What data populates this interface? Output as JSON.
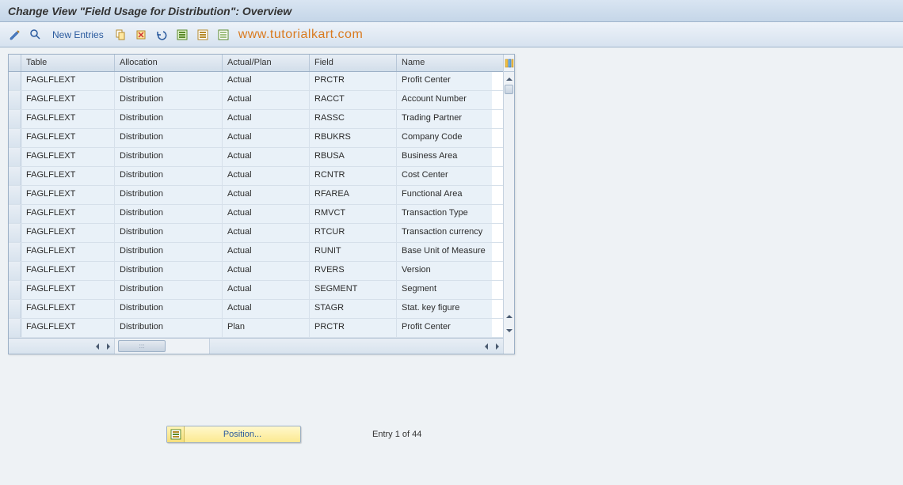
{
  "title": "Change View \"Field Usage for Distribution\": Overview",
  "toolbar": {
    "new_entries": "New Entries"
  },
  "watermark": "www.tutorialkart.com",
  "grid": {
    "headers": {
      "table": "Table",
      "allocation": "Allocation",
      "actual_plan": "Actual/Plan",
      "field": "Field",
      "name": "Name"
    },
    "rows": [
      {
        "table": "FAGLFLEXT",
        "allocation": "Distribution",
        "actual_plan": "Actual",
        "field": "PRCTR",
        "name": "Profit Center"
      },
      {
        "table": "FAGLFLEXT",
        "allocation": "Distribution",
        "actual_plan": "Actual",
        "field": "RACCT",
        "name": "Account Number"
      },
      {
        "table": "FAGLFLEXT",
        "allocation": "Distribution",
        "actual_plan": "Actual",
        "field": "RASSC",
        "name": "Trading Partner"
      },
      {
        "table": "FAGLFLEXT",
        "allocation": "Distribution",
        "actual_plan": "Actual",
        "field": "RBUKRS",
        "name": "Company Code"
      },
      {
        "table": "FAGLFLEXT",
        "allocation": "Distribution",
        "actual_plan": "Actual",
        "field": "RBUSA",
        "name": "Business Area"
      },
      {
        "table": "FAGLFLEXT",
        "allocation": "Distribution",
        "actual_plan": "Actual",
        "field": "RCNTR",
        "name": "Cost Center"
      },
      {
        "table": "FAGLFLEXT",
        "allocation": "Distribution",
        "actual_plan": "Actual",
        "field": "RFAREA",
        "name": "Functional Area"
      },
      {
        "table": "FAGLFLEXT",
        "allocation": "Distribution",
        "actual_plan": "Actual",
        "field": "RMVCT",
        "name": "Transaction Type"
      },
      {
        "table": "FAGLFLEXT",
        "allocation": "Distribution",
        "actual_plan": "Actual",
        "field": "RTCUR",
        "name": "Transaction currency"
      },
      {
        "table": "FAGLFLEXT",
        "allocation": "Distribution",
        "actual_plan": "Actual",
        "field": "RUNIT",
        "name": "Base Unit of Measure"
      },
      {
        "table": "FAGLFLEXT",
        "allocation": "Distribution",
        "actual_plan": "Actual",
        "field": "RVERS",
        "name": "Version"
      },
      {
        "table": "FAGLFLEXT",
        "allocation": "Distribution",
        "actual_plan": "Actual",
        "field": "SEGMENT",
        "name": "Segment"
      },
      {
        "table": "FAGLFLEXT",
        "allocation": "Distribution",
        "actual_plan": "Actual",
        "field": "STAGR",
        "name": "Stat. key figure"
      },
      {
        "table": "FAGLFLEXT",
        "allocation": "Distribution",
        "actual_plan": "Plan",
        "field": "PRCTR",
        "name": "Profit Center"
      }
    ]
  },
  "footer": {
    "position_label": "Position...",
    "entry_text": "Entry 1 of 44"
  }
}
